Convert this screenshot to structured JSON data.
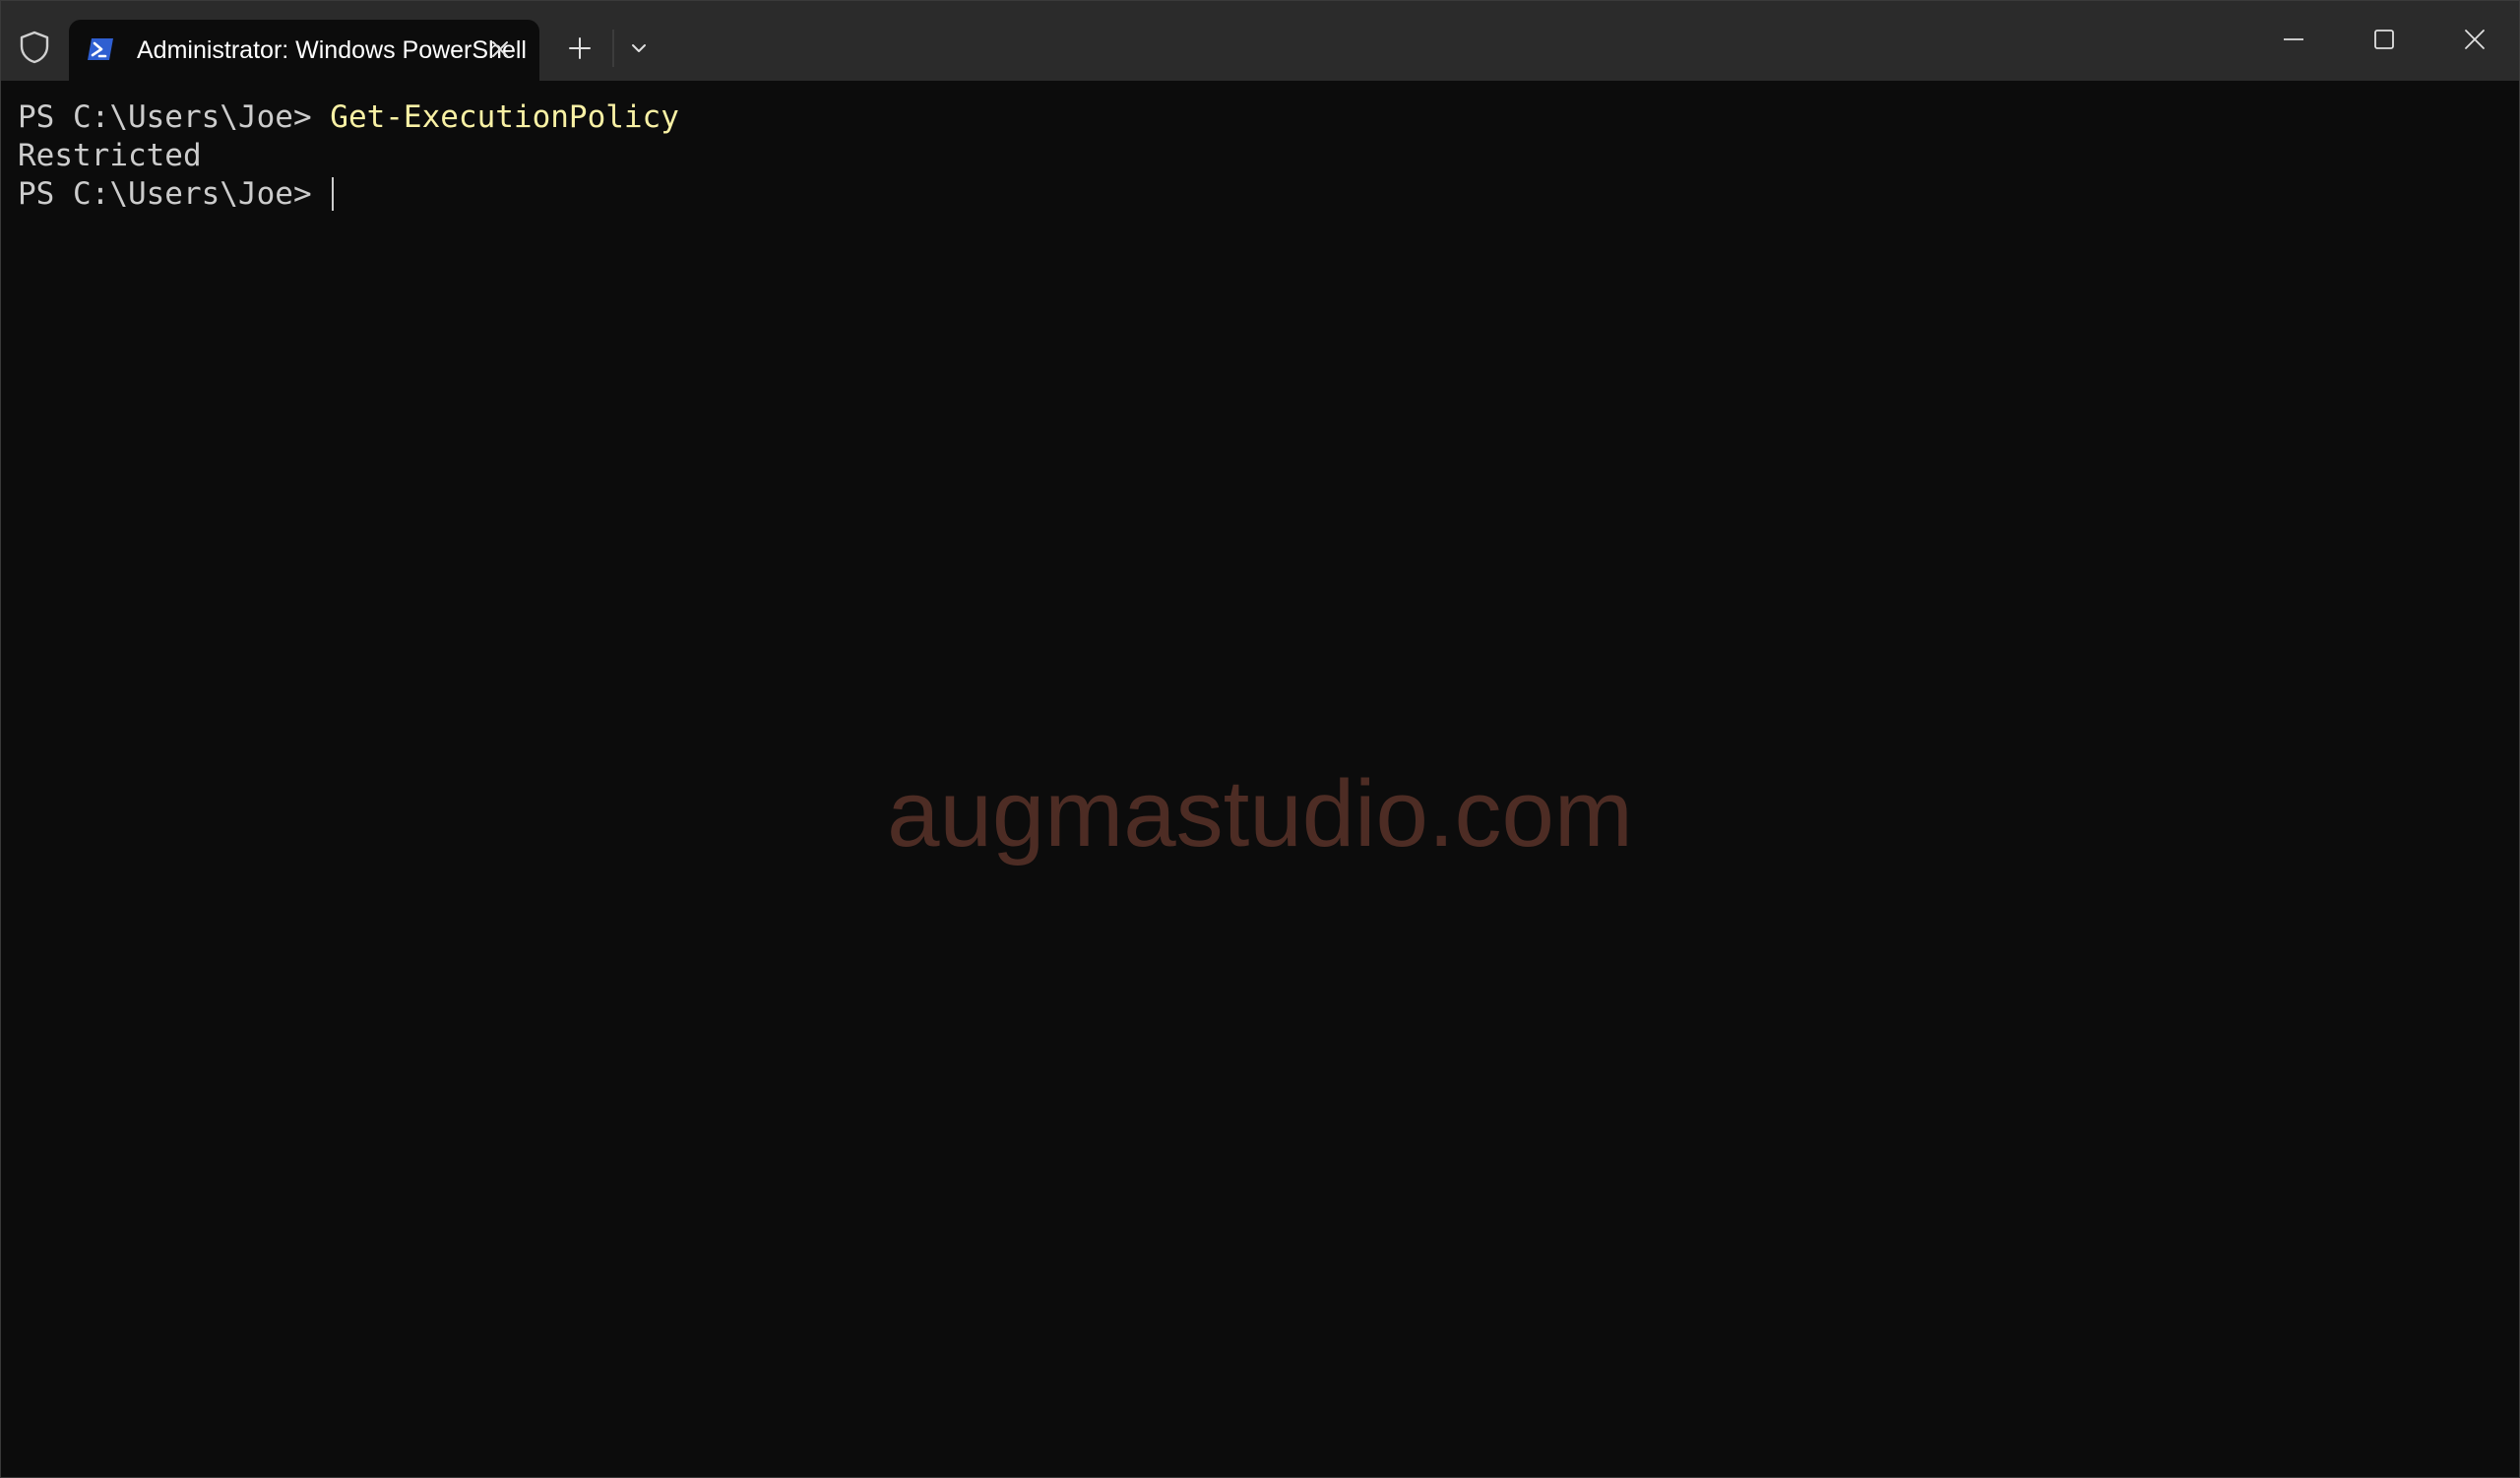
{
  "titlebar": {
    "tab_title": "Administrator: Windows PowerShell",
    "icons": {
      "admin": "shield-icon",
      "tab": "powershell-icon",
      "close_tab": "close-icon",
      "new_tab": "plus-icon",
      "dropdown": "chevron-down-icon",
      "minimize": "minimize-icon",
      "maximize": "maximize-icon",
      "close_window": "close-icon"
    }
  },
  "terminal": {
    "lines": [
      {
        "prompt": "PS C:\\Users\\Joe> ",
        "command": "Get-ExecutionPolicy"
      },
      {
        "output": "Restricted"
      },
      {
        "prompt": "PS C:\\Users\\Joe> ",
        "command": ""
      }
    ],
    "watermark": "augmastudio.com"
  },
  "colors": {
    "titlebar_bg": "#2b2b2b",
    "terminal_bg": "#0c0c0c",
    "text": "#cccccc",
    "command": "#f9f1a5",
    "watermark": "#4d2c24",
    "powershell_icon": "#2f5fd1"
  }
}
